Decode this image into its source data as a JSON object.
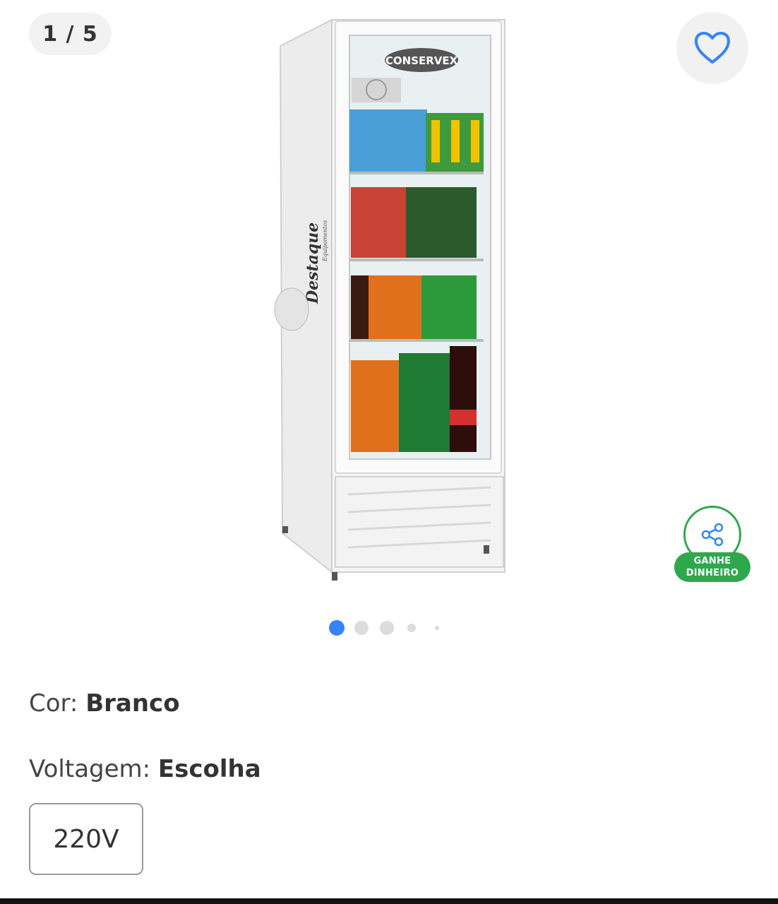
{
  "gallery": {
    "counter": "1 / 5",
    "favorite_icon": "heart-outline-icon",
    "share": {
      "icon": "share-icon",
      "label_line1": "GANHE",
      "label_line2": "DINHEIRO"
    },
    "dots": {
      "count": 5,
      "active_index": 0
    },
    "image": {
      "brand": "CONSERVEX",
      "side_logo": "Destaque",
      "side_logo_sub": "Equipamentos"
    }
  },
  "variants": {
    "cor_label": "Cor:",
    "cor_value": "Branco",
    "voltagem_label": "Voltagem:",
    "voltagem_value": "Escolha",
    "voltagem_option": "220V"
  },
  "colors": {
    "accent": "#3483fa",
    "green": "#2ea84d",
    "text": "#333333"
  }
}
